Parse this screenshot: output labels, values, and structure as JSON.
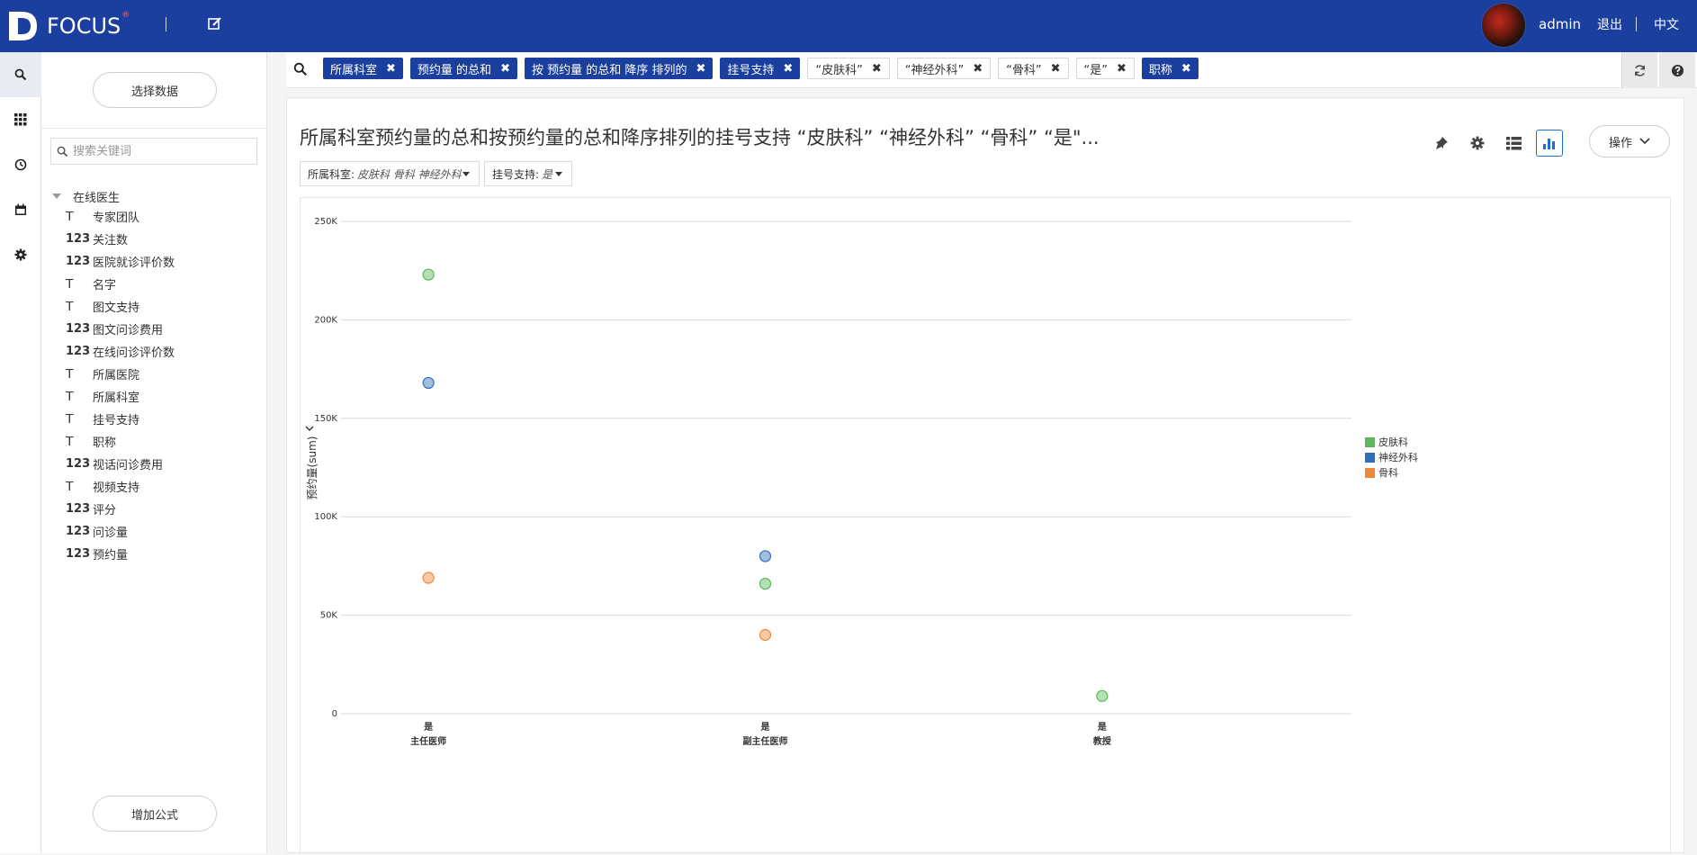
{
  "header": {
    "brand": "FOCUS",
    "brand_mark": "®",
    "user": "admin",
    "logout": "退出",
    "lang": "中文"
  },
  "rail": [
    "search-icon",
    "grid-icon",
    "history-icon",
    "calendar-icon",
    "gear-icon"
  ],
  "sidebar": {
    "select_data": "选择数据",
    "search_placeholder": "搜索关键词",
    "root": "在线医生",
    "fields": [
      {
        "type": "T",
        "label": "专家团队"
      },
      {
        "type": "123",
        "label": "关注数"
      },
      {
        "type": "123",
        "label": "医院就诊评价数"
      },
      {
        "type": "T",
        "label": "名字"
      },
      {
        "type": "T",
        "label": "图文支持"
      },
      {
        "type": "123",
        "label": "图文问诊费用"
      },
      {
        "type": "123",
        "label": "在线问诊评价数"
      },
      {
        "type": "T",
        "label": "所属医院"
      },
      {
        "type": "T",
        "label": "所属科室"
      },
      {
        "type": "T",
        "label": "挂号支持"
      },
      {
        "type": "T",
        "label": "职称"
      },
      {
        "type": "123",
        "label": "视话问诊费用"
      },
      {
        "type": "T",
        "label": "视频支持"
      },
      {
        "type": "123",
        "label": "评分"
      },
      {
        "type": "123",
        "label": "问诊量"
      },
      {
        "type": "123",
        "label": "预约量"
      }
    ],
    "add_formula": "增加公式"
  },
  "filters": [
    {
      "label": "所属科室",
      "style": "solid"
    },
    {
      "label": "预约量 的总和",
      "style": "solid"
    },
    {
      "label": "按 预约量 的总和 降序 排列的",
      "style": "solid"
    },
    {
      "label": "挂号支持",
      "style": "solid"
    },
    {
      "label": "“皮肤科”",
      "style": "outline"
    },
    {
      "label": "“神经外科”",
      "style": "outline"
    },
    {
      "label": "“骨科”",
      "style": "outline"
    },
    {
      "label": "“是”",
      "style": "outline"
    },
    {
      "label": "职称",
      "style": "solid"
    }
  ],
  "card": {
    "title": "所属科室预约量的总和按预约量的总和降序排列的挂号支持 “皮肤科” “神经外科” “骨科” “是\"...",
    "ops": "操作",
    "dd1_label": "所属科室:",
    "dd1_value": "皮肤科  骨科  神经外科",
    "dd2_label": "挂号支持:",
    "dd2_value": "是"
  },
  "chart_data": {
    "type": "scatter",
    "ylabel": "预约量(sum)",
    "ylim": [
      0,
      250000
    ],
    "yticks": [
      "0",
      "50K",
      "100K",
      "150K",
      "200K",
      "250K"
    ],
    "categories": [
      {
        "top": "是",
        "bottom": "主任医师"
      },
      {
        "top": "是",
        "bottom": "副主任医师"
      },
      {
        "top": "是",
        "bottom": "教授"
      }
    ],
    "series": [
      {
        "name": "皮肤科",
        "color": "#5cb85c",
        "values": [
          223000,
          66000,
          9000
        ]
      },
      {
        "name": "神经外科",
        "color": "#2f6fba",
        "values": [
          168000,
          80000,
          null
        ]
      },
      {
        "name": "骨科",
        "color": "#f0883a",
        "values": [
          69000,
          40000,
          null
        ]
      }
    ],
    "legend_position": "right",
    "grid": true
  }
}
